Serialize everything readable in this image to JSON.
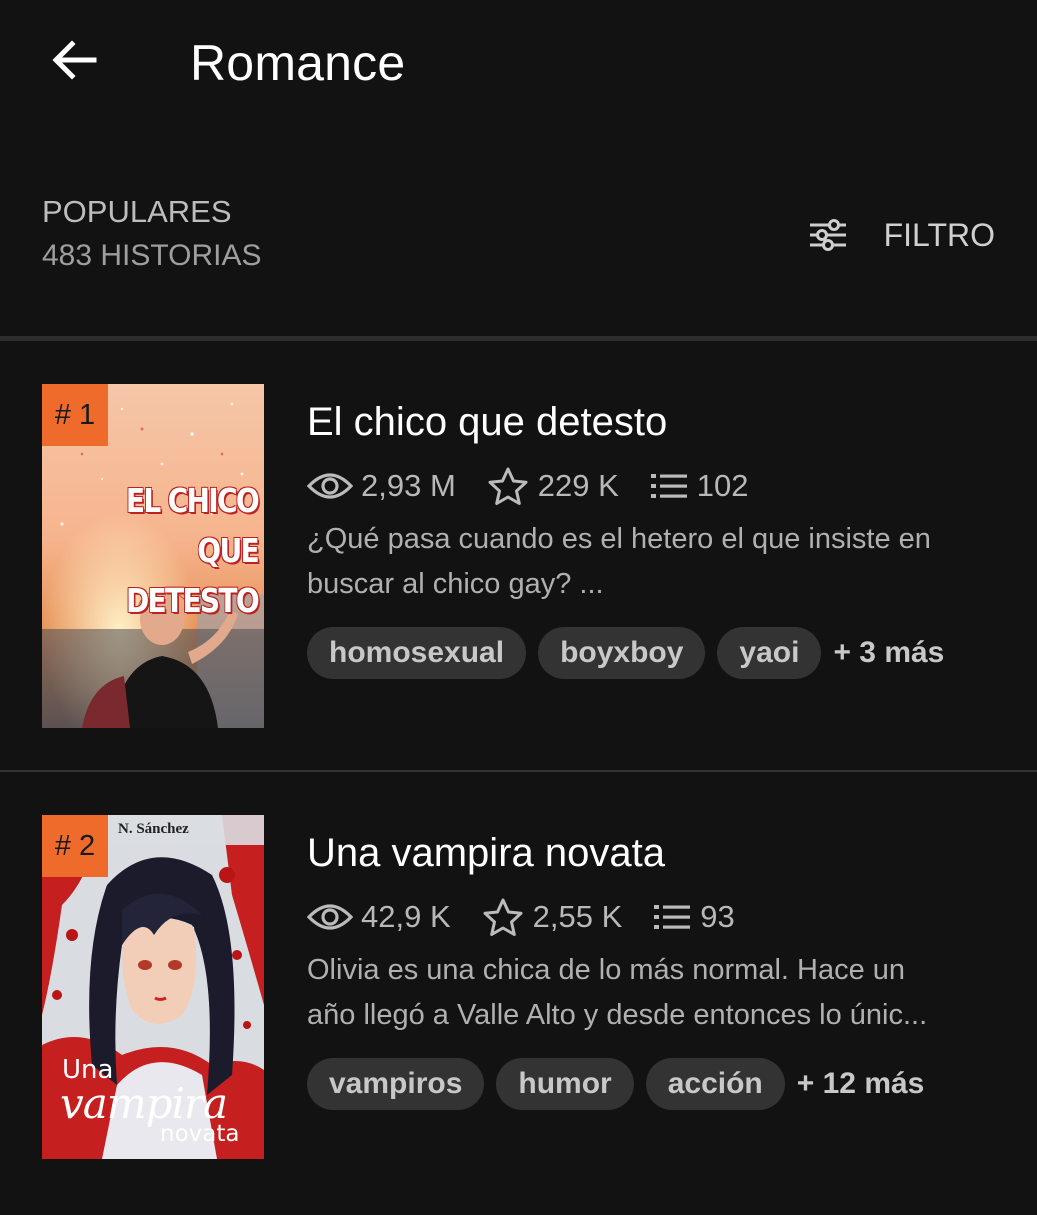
{
  "header": {
    "title": "Romance",
    "back_icon": "arrow-left-icon"
  },
  "sort": {
    "label": "POPULARES",
    "count": "483 HISTORIAS",
    "filter_label": "FILTRO",
    "filter_icon": "sliders-icon"
  },
  "colors": {
    "background": "#121212",
    "rank_badge": "#ef6b2c",
    "tag_bg": "#333333"
  },
  "stories": [
    {
      "rank": "# 1",
      "title": "El chico que detesto",
      "reads": "2,93 M",
      "votes": "229 K",
      "parts": "102",
      "description_lines": [
        "¿Qué pasa cuando es el hetero el que insiste en",
        "buscar al chico gay? ..."
      ],
      "tags": [
        "homosexual",
        "boyxboy",
        "yaoi"
      ],
      "more_tags": "+ 3 más",
      "cover_text": [
        "EL CHICO",
        "QUE DETESTO"
      ]
    },
    {
      "rank": "# 2",
      "title": "Una vampira novata",
      "reads": "42,9 K",
      "votes": "2,55 K",
      "parts": "93",
      "description_lines": [
        "Olivia es una chica de lo más normal. Hace un",
        "año llegó a Valle Alto y desde entonces lo únic..."
      ],
      "tags": [
        "vampiros",
        "humor",
        "acción"
      ],
      "more_tags": "+ 12 más",
      "cover_text": [
        "N. Sánchez",
        "Una",
        "vampira",
        "novata"
      ]
    }
  ]
}
